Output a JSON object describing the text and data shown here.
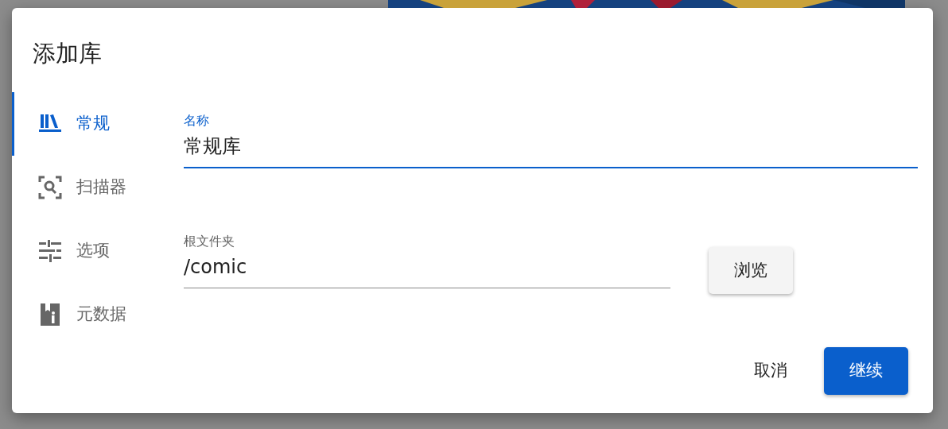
{
  "dialog": {
    "title": "添加库",
    "tabs": [
      {
        "label": "常规",
        "selected": true
      },
      {
        "label": "扫描器",
        "selected": false
      },
      {
        "label": "选项",
        "selected": false
      },
      {
        "label": "元数据",
        "selected": false
      }
    ],
    "fields": [
      {
        "label": "名称",
        "value": "常规库",
        "focused": true
      },
      {
        "label": "根文件夹",
        "value": "/comic",
        "focused": false,
        "button": "浏览"
      }
    ],
    "buttons": [
      {
        "label": "取消",
        "kind": "text"
      },
      {
        "label": "继续",
        "kind": "primary"
      }
    ]
  }
}
